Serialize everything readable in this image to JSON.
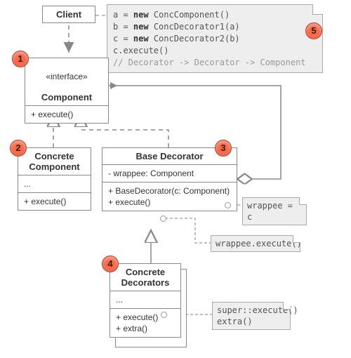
{
  "client": {
    "label": "Client"
  },
  "component": {
    "stereo": "«interface»",
    "label": "Component",
    "op": "+ execute()"
  },
  "concrete_component": {
    "label": "Concrete\nComponent",
    "dots": "...",
    "op": "+ execute()"
  },
  "base_decorator": {
    "label": "Base Decorator",
    "field": "- wrappee: Component",
    "ctor": "+ BaseDecorator(c: Component)",
    "op": "+ execute()"
  },
  "concrete_decorators": {
    "label": "Concrete\nDecorators",
    "dots": "...",
    "op1": "+ execute()",
    "op2": "+ extra()"
  },
  "note_client": {
    "l1a": "a = ",
    "l1k": "new",
    "l1b": " ConcComponent()",
    "l2a": "b = ",
    "l2k": "new",
    "l2b": " ConcDecorator1(a)",
    "l3a": "c = ",
    "l3k": "new",
    "l3b": " ConcDecorator2(b)",
    "l4": "c.execute()",
    "l5": "// Decorator -> Decorator -> Component"
  },
  "note_ctor": "wrappee = c",
  "note_exec": "wrappee.execute()",
  "note_cd": {
    "l1k": "super",
    "l1b": "::execute()",
    "l2": "extra()"
  },
  "badges": {
    "b1": "1",
    "b2": "2",
    "b3": "3",
    "b4": "4",
    "b5": "5"
  }
}
